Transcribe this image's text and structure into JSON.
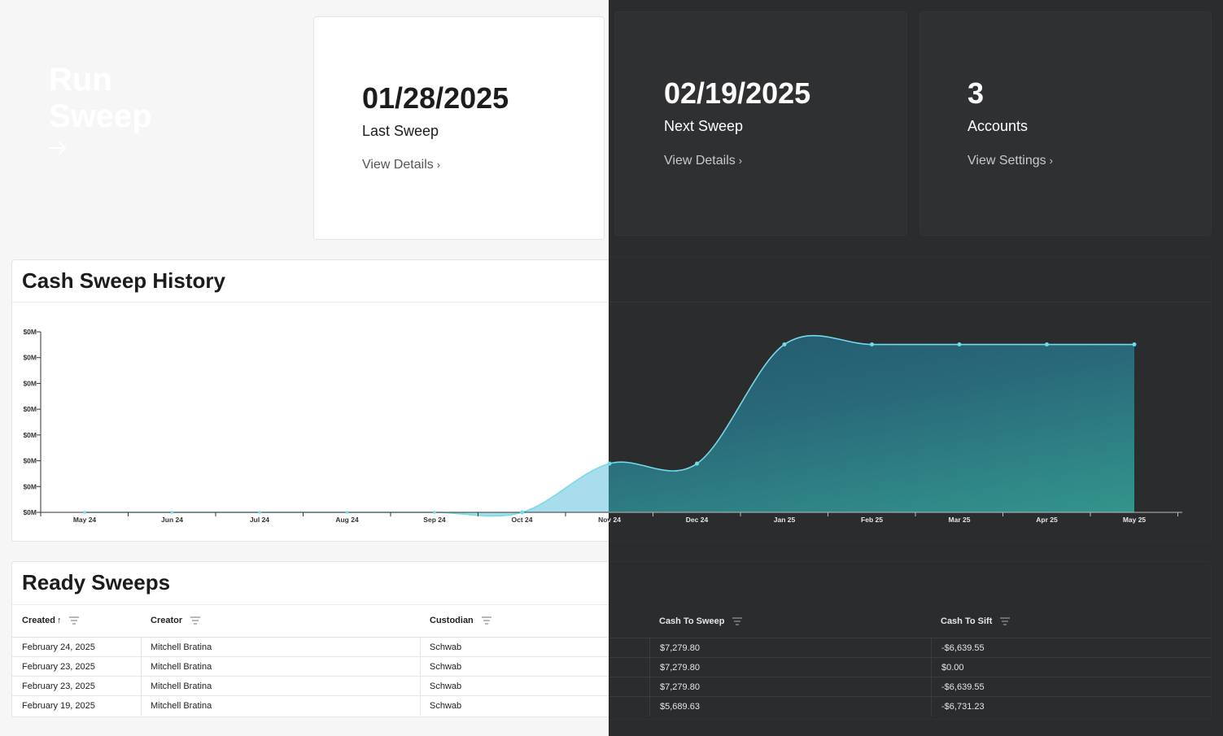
{
  "run_sweep": {
    "title": "Run Sweep",
    "arrow_icon": "arrow-right-icon"
  },
  "last_sweep": {
    "date": "01/28/2025",
    "label": "Last Sweep",
    "link": "View Details",
    "chevron": "›"
  },
  "next_sweep": {
    "date": "02/19/2025",
    "label": "Next Sweep",
    "link": "View Details",
    "chevron": "›"
  },
  "accounts": {
    "count": "3",
    "label": "Accounts",
    "link": "View Settings",
    "chevron": "›"
  },
  "history": {
    "title": "Cash Sweep History"
  },
  "chart_data": {
    "type": "area",
    "title": "Cash Sweep History",
    "x": [
      "May 24",
      "Jun 24",
      "Jul 24",
      "Aug 24",
      "Sep 24",
      "Oct 24",
      "Nov 24",
      "Dec 24",
      "Jan 25",
      "Feb 25",
      "Mar 25",
      "Apr 25",
      "May 25"
    ],
    "y_ticks": [
      "$0M",
      "$0M",
      "$0M",
      "$0M",
      "$0M",
      "$0M",
      "$0M",
      "$0M"
    ],
    "series": [
      {
        "values": [
          0,
          0,
          0,
          0,
          0,
          0,
          0.27,
          0.27,
          0.93,
          0.93,
          0.93,
          0.93,
          0.93
        ]
      }
    ],
    "points_shown_from": 5,
    "ylim": [
      0,
      1
    ],
    "grid": false,
    "legend": "none",
    "colors": {
      "line": "#6fdcea",
      "fill_light": "#a5dbea",
      "fill_dark_top": "#1f5168",
      "fill_dark_bottom": "#2f8c88"
    }
  },
  "ready": {
    "title": "Ready Sweeps",
    "columns": [
      {
        "label": "Created",
        "sort": "↑"
      },
      {
        "label": "Creator"
      },
      {
        "label": "Custodian"
      },
      {
        "label": "Cash To Sweep"
      },
      {
        "label": "Cash To Sift"
      }
    ],
    "rows": [
      {
        "created": "February 24, 2025",
        "creator": "Mitchell Bratina",
        "custodian": "Schwab",
        "cash_to_sweep": "$7,279.80",
        "cash_to_sift": "-$6,639.55"
      },
      {
        "created": "February 23, 2025",
        "creator": "Mitchell Bratina",
        "custodian": "Schwab",
        "cash_to_sweep": "$7,279.80",
        "cash_to_sift": "$0.00"
      },
      {
        "created": "February 23, 2025",
        "creator": "Mitchell Bratina",
        "custodian": "Schwab",
        "cash_to_sweep": "$7,279.80",
        "cash_to_sift": "-$6,639.55"
      },
      {
        "created": "February 19, 2025",
        "creator": "Mitchell Bratina",
        "custodian": "Schwab",
        "cash_to_sweep": "$5,689.63",
        "cash_to_sift": "-$6,731.23"
      }
    ]
  }
}
